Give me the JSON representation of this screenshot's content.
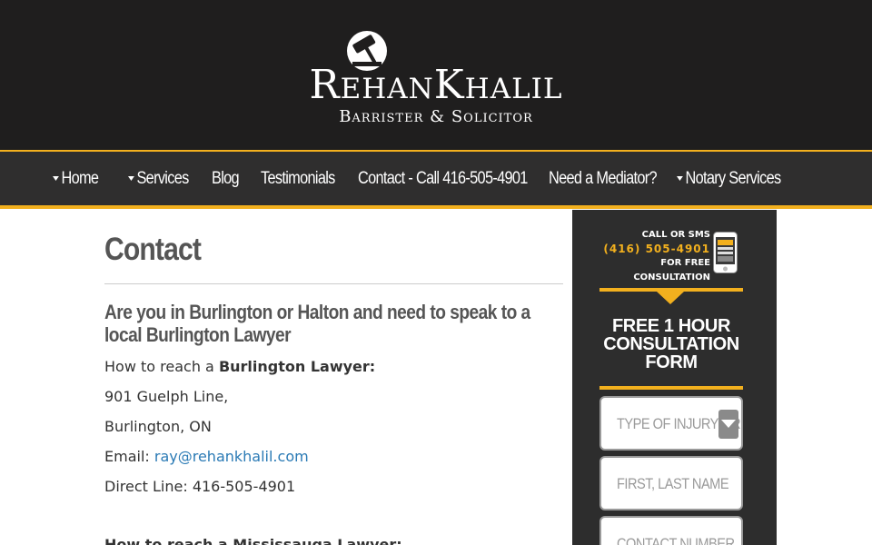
{
  "header": {
    "logo_name": "RehanKhalil",
    "logo_tagline": "Barrister & Solicitor",
    "logo_icon": "gavel-icon"
  },
  "nav": {
    "items": [
      {
        "label": "Home",
        "has_dropdown": true
      },
      {
        "label": "Services",
        "has_dropdown": true
      },
      {
        "label": "Blog",
        "has_dropdown": false
      },
      {
        "label": "Testimonials",
        "has_dropdown": false
      },
      {
        "label": "Contact - Call 416-505-4901",
        "has_dropdown": false
      },
      {
        "label": "Need a Mediator?",
        "has_dropdown": false
      },
      {
        "label": "Notary Services",
        "has_dropdown": true
      }
    ]
  },
  "main": {
    "title": "Contact",
    "subheading": "Are you in Burlington or Halton and need to speak to a local Burlington Lawyer",
    "reach_prefix": "How to reach a ",
    "reach_bold": "Burlington Lawyer:",
    "address_line1": "901 Guelph Line,",
    "address_line2": "Burlington, ON",
    "email_label": "Email: ",
    "email": "ray@rehankhalil.com",
    "direct_line": "Direct Line: 416-505-4901",
    "next_prefix": "How to reach a ",
    "next_bold": "Mississauga Lawyer:"
  },
  "sidebar": {
    "cta_line1": "CALL OR SMS",
    "cta_phone": "(416) 505-4901",
    "cta_line3": "FOR FREE",
    "cta_line4": "CONSULTATION",
    "form_title_line1": "FREE 1 HOUR",
    "form_title_line2": "CONSULTATION",
    "form_title_line3": "FORM",
    "fields": {
      "injury_placeholder": "TYPE OF INJURY OR",
      "name_placeholder": "FIRST, LAST NAME",
      "phone_placeholder": "CONTACT NUMBER"
    }
  },
  "colors": {
    "accent": "#f2b01e",
    "header_bg": "#1f1e1e",
    "nav_bg": "#2f2e2e",
    "link": "#2a7ab5"
  }
}
